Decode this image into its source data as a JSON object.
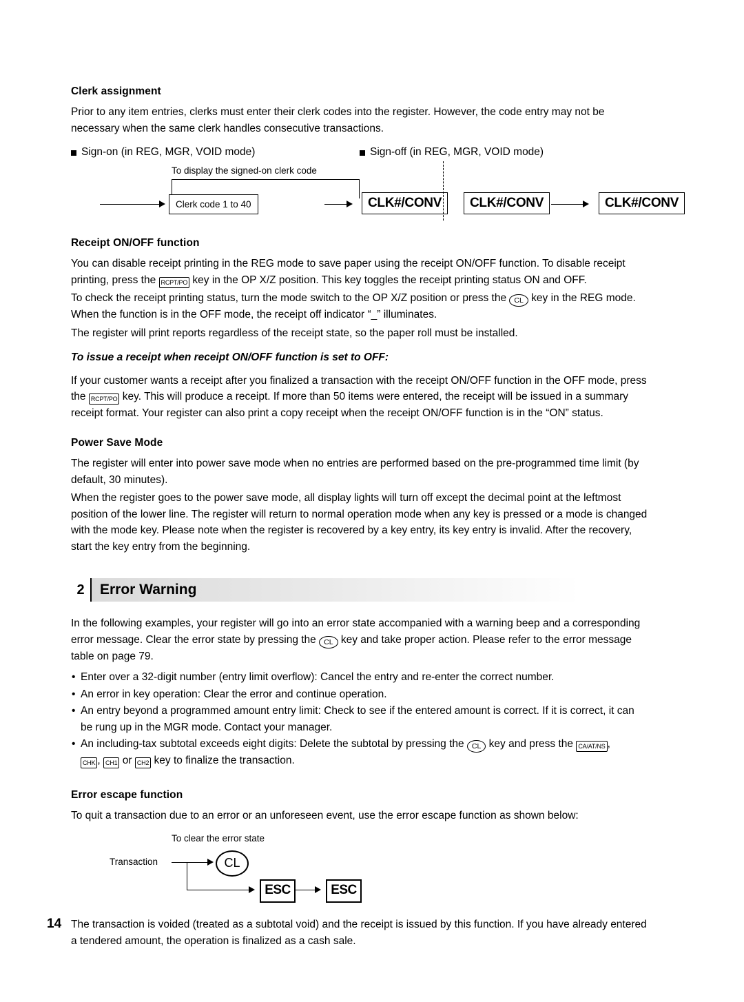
{
  "page": {
    "number": "14"
  },
  "clerk": {
    "heading": "Clerk assignment",
    "para1": "Prior to any item entries, clerks must enter their clerk codes into the register.  However, the code entry may not be necessary when the same clerk handles consecutive transactions.",
    "signon_label": "Sign-on (in REG, MGR, VOID mode)",
    "signoff_label": "Sign-off (in REG, MGR, VOID mode)",
    "diagram": {
      "caption": "To display the signed-on clerk code",
      "clerk_code_box": "Clerk code 1 to 40",
      "clk_conv_1": "CLK#/CONV",
      "clk_conv_2": "CLK#/CONV",
      "clk_conv_3": "CLK#/CONV"
    }
  },
  "receipt": {
    "heading": "Receipt ON/OFF function",
    "p1a": "You can disable receipt printing in the REG mode to save paper using the receipt ON/OFF function. To disable receipt printing, press the ",
    "key_rcptpo": "RCPT/PO",
    "p1b": " key in the OP X/Z position.  This key toggles the receipt printing status ON and OFF.",
    "p2a": "To check the receipt printing status, turn the mode switch to the OP X/Z position or press the ",
    "key_cl": "CL",
    "p2b": " key in the REG mode. When the function is in the OFF mode, the receipt off indicator “_” illuminates.",
    "p3": "The register will print reports regardless of the receipt state, so the paper roll must be installed.",
    "italic_heading": "To issue a receipt when receipt ON/OFF function is set to OFF:",
    "p4a": "If your customer wants a receipt after you finalized a transaction with the receipt ON/OFF function in the OFF mode, press the ",
    "p4b": " key.  This will produce a receipt.  If more than 50 items were entered, the receipt will be issued in a summary receipt format.  Your register can also print a copy receipt when the receipt ON/OFF function is in the “ON” status."
  },
  "power_save": {
    "heading": "Power Save Mode",
    "p1": "The register will enter into power save mode when no entries are performed based on the pre-programmed time limit (by default, 30 minutes).",
    "p2": "When the register goes to the power save mode, all display lights will turn off except the decimal point at the leftmost position of the lower line.  The register will return to normal operation mode when any key is pressed or a mode is changed with the mode key.  Please note when the register is recovered by a key entry, its key entry is invalid.  After the recovery, start the key entry from the beginning."
  },
  "error_warning": {
    "section_number": "2",
    "section_title": "Error Warning",
    "intro_a": "In the following examples, your register will go into an error state accompanied with a warning beep and a corresponding error message.  Clear the error state by pressing the ",
    "key_cl": "CL",
    "intro_b": " key and take proper action.  Please refer to the error message table on page 79.",
    "bullets": [
      "Enter over a 32-digit number (entry limit overflow): Cancel the entry and re-enter the correct number.",
      "An error in key operation: Clear the error and continue operation.",
      "An entry beyond a programmed amount entry limit: Check to see if the entered amount is correct.  If it is correct, it can be rung up in the MGR mode.  Contact your manager."
    ],
    "bullet4_a": "An including-tax subtotal exceeds eight digits: Delete the subtotal by pressing the ",
    "bullet4_b": " key and press the ",
    "key_caatns": "CA/AT/NS",
    "bullet4_c": ", ",
    "key_chk": "CHK",
    "bullet4_d": ", ",
    "key_ch1": "CH1",
    "bullet4_e": " or ",
    "key_ch2": "CH2",
    "bullet4_f": " key to finalize the transaction."
  },
  "error_escape": {
    "heading": "Error escape function",
    "para": "To quit a transaction due to an error or an unforeseen event, use the error escape function as shown below:",
    "diagram": {
      "caption": "To clear the error state",
      "transaction_label": "Transaction",
      "cl_key": "CL",
      "esc_key_1": "ESC",
      "esc_key_2": "ESC"
    },
    "closing": "The transaction is voided (treated as a subtotal void) and the receipt is issued by this function.  If you have already entered a tendered amount, the operation is finalized as a cash sale."
  }
}
